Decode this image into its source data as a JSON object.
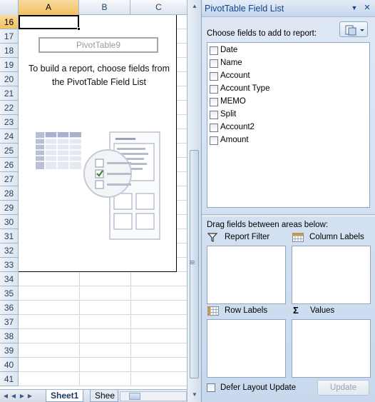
{
  "spreadsheet": {
    "columns": [
      "A",
      "B",
      "C"
    ],
    "selected_column": "A",
    "rows": [
      "16",
      "17",
      "18",
      "19",
      "20",
      "21",
      "22",
      "23",
      "24",
      "25",
      "26",
      "27",
      "28",
      "29",
      "30",
      "31",
      "32",
      "33",
      "34",
      "35",
      "36",
      "37",
      "38",
      "39",
      "40",
      "41"
    ],
    "selected_row": "16",
    "pivot_name": "PivotTable9",
    "pivot_message": "To build a report, choose fields from the PivotTable Field List",
    "sheet_tabs": [
      "Sheet1",
      "Shee"
    ],
    "active_tab": "Sheet1",
    "tab_nav": [
      "first-sheet",
      "prev-sheet",
      "next-sheet",
      "last-sheet"
    ]
  },
  "field_list": {
    "title": "PivotTable Field List",
    "header_buttons": {
      "dropdown": "▼",
      "close": "✕"
    },
    "choose_label": "Choose fields to add to report:",
    "layout_icon": "field-list-layout-icon",
    "fields": [
      {
        "label": "Date",
        "checked": false
      },
      {
        "label": "Name",
        "checked": false
      },
      {
        "label": "Account",
        "checked": false
      },
      {
        "label": "Account Type",
        "checked": false
      },
      {
        "label": "MEMO",
        "checked": false
      },
      {
        "label": "Split",
        "checked": false
      },
      {
        "label": "Account2",
        "checked": false
      },
      {
        "label": "Amount",
        "checked": false
      }
    ],
    "drag_label": "Drag fields between areas below:",
    "areas": {
      "report_filter": {
        "label": "Report Filter",
        "icon": "filter-icon"
      },
      "column_labels": {
        "label": "Column Labels",
        "icon": "column-labels-icon"
      },
      "row_labels": {
        "label": "Row Labels",
        "icon": "row-labels-icon"
      },
      "values": {
        "label": "Values",
        "icon": "sigma-icon"
      }
    },
    "defer_label": "Defer Layout Update",
    "defer_checked": false,
    "update_label": "Update",
    "update_enabled": false
  }
}
